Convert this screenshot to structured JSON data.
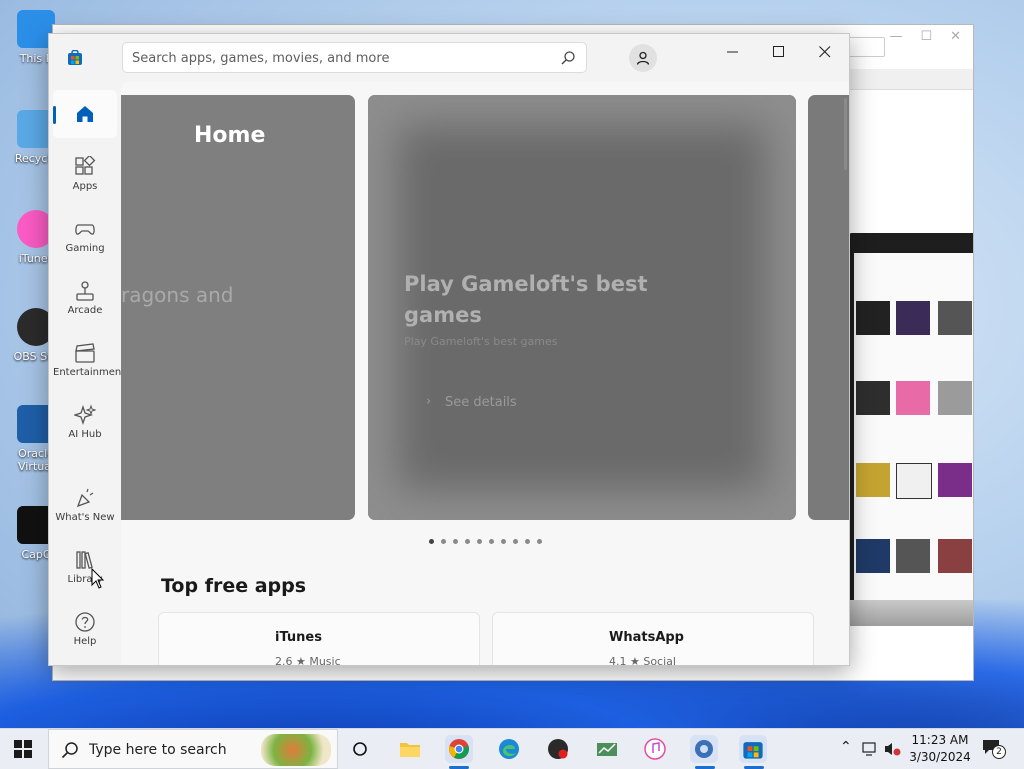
{
  "desktop": {
    "icons": [
      {
        "label": "This P",
        "color": "#2b8fe8"
      },
      {
        "label": "Recycle",
        "color": "#5aa9e6"
      },
      {
        "label": "iTunes",
        "color": "#fb5bc5"
      },
      {
        "label": "OBS Stu",
        "color": "#2b2b2b"
      },
      {
        "label": "Oracle",
        "label2": "Virtual",
        "color": "#1f5fa8"
      },
      {
        "label": "CapC",
        "color": "#111111"
      }
    ]
  },
  "store": {
    "search_placeholder": "Search apps, games, movies, and more",
    "nav": [
      {
        "label": "",
        "icon": "home-icon",
        "active": true
      },
      {
        "label": "Apps",
        "icon": "apps-icon"
      },
      {
        "label": "Gaming",
        "icon": "gamepad-icon"
      },
      {
        "label": "Arcade",
        "icon": "joystick-icon"
      },
      {
        "label": "Entertainment",
        "icon": "clapperboard-icon"
      },
      {
        "label": "AI Hub",
        "icon": "sparkle-icon"
      },
      {
        "label": "What's New",
        "icon": "party-icon"
      },
      {
        "label": "Library",
        "icon": "library-icon"
      },
      {
        "label": "Help",
        "icon": "help-icon"
      }
    ],
    "hero": {
      "page_title": "Home",
      "left_text": "ragons and",
      "headline": "Play Gameloft's best games",
      "subtitle": "Play Gameloft's best games",
      "see_details": "See details",
      "dot_count": 10,
      "active_dot": 0
    },
    "section": {
      "title": "Top free apps",
      "cards": [
        {
          "name": "iTunes",
          "meta": "2.6 ★   Music"
        },
        {
          "name": "WhatsApp",
          "meta": "4.1 ★   Social"
        }
      ]
    }
  },
  "taskbar": {
    "search_text": "Type here to search",
    "time": "11:23 AM",
    "date": "3/30/2024",
    "notification_count": "2"
  },
  "colors": {
    "accent": "#005fb8",
    "hero_gray": "#6a6a6a"
  }
}
